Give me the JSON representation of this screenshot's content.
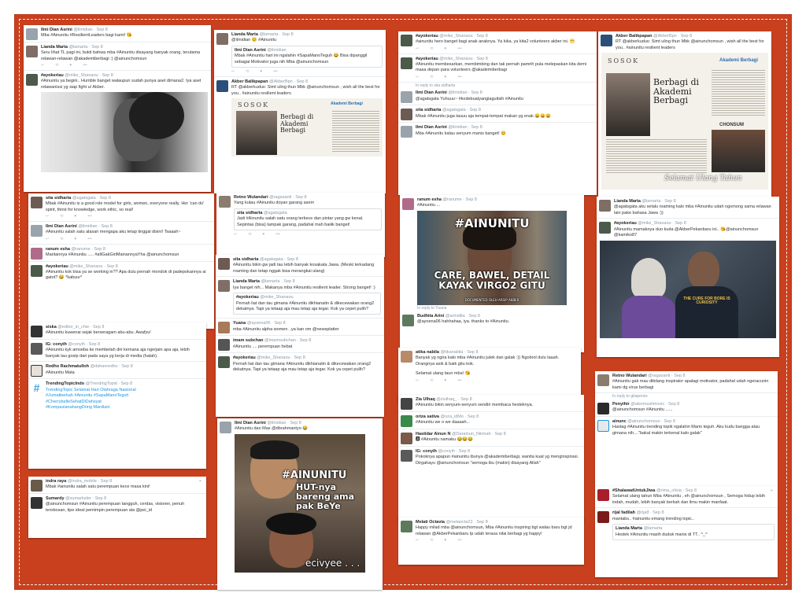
{
  "cards": {
    "c1": {
      "tweets": [
        {
          "name": "Ilmi Dian Asrini",
          "handle": "@ilmidian · Sep 8",
          "text": "Mba #Ainunitu #ResilientLeaders bagi kami! 😘"
        },
        {
          "name": "Lianda Marta",
          "handle": "@lamarta · Sep 8",
          "text": "Seru lihat TL pagi ini, bukti bahwa mba #Ainunitu disayang banyak orang, terutama relawan-relawan @akademiberbagi :) @ainunchomsun"
        },
        {
          "name": "#ayokeriau",
          "handle": "@mike_Shanaou · Sep 8",
          "text": "#Ainunitu ya begini.. Humble banget walaupun sudah punya aset dimana2. Iya aset relawanissi yg siap fight u/ Akber."
        }
      ]
    },
    "c2": {
      "tweets": [
        {
          "name": "Lianda Marta",
          "handle": "@lamarta · Sep 8",
          "text": "@ilmidian 😊 #Ainunitu"
        },
        {
          "name": "Akber Balikpapan",
          "handle": "@AkberBpn · Sep 8",
          "text": "RT @akberkudus: Simt uling thun Mbk @ainunchomsun , wish all the best for you.. #ainunitu resilient leaders"
        }
      ],
      "quote": {
        "name": "Ilmi Dian Asrini",
        "handle": "@ilmidian",
        "text": "Mbak #Ainunitu hari ini ngalahin #SapaManoTeguh 😂 Bisa dipanggil sebagai Motivator juga nih Mba @ainunchomsun"
      },
      "newspaper": {
        "section": "SOSOK",
        "headline": "Berbagi di Akademi Berbagi",
        "logo": "Akademi Berbagi"
      }
    },
    "c3": {
      "tweets": [
        {
          "name": "#ayokeriau",
          "handle": "@mike_Shanaou · Sep 8",
          "text": "#ainunitu hero banget bagi anak anaknya. Ya kika, ya kita2 volunteers akber ini. 😁"
        },
        {
          "name": "#ayokeriau",
          "handle": "@mike_Shanaou · Sep 8",
          "text": "#Ainunitu membesarkan, membimbing dan tak pernah pamrih pula melepaskan kita demi masa depan para volunteers @akademiberbagi"
        },
        {
          "name": "Ilmi Dian Asrini",
          "handle": "@ilmidian · Sep 8",
          "text": "@agatsgata Yuhuuu~ #kodebuatyangiaguitsih #Ainunitu",
          "replyto": "In reply to sita sidharta"
        },
        {
          "name": "sita sidharta",
          "handle": "@agatsgata · Sep 8",
          "text": "Mbak #Ainunitu juga tauuu aja tempat-tempat makan yg enak 😀😀😀"
        },
        {
          "name": "Ilmi Dian Asrini",
          "handle": "@ilmidian · Sep 8",
          "text": "Mba #Ainunitu kalau senyum manis banget! 😊"
        }
      ]
    },
    "c4": {
      "tweets": [
        {
          "name": "Akber Balikpapan",
          "handle": "@AkberBpn · Sep 8",
          "text": "RT @akberkudus: Simt uling thun Mbk @ainunchomsun , wish all the best for you.. #ainunitu resilient leaders"
        }
      ],
      "newspaper": {
        "section": "SOSOK",
        "headline": "Berbagi di Akademi Berbagi",
        "logo": "Akademi Berbagi",
        "caption": "Selamat Ulang Tahun",
        "extra": "CHONSUM"
      }
    },
    "c5": {
      "tweets": [
        {
          "name": "sita sidharta",
          "handle": "@agatsgata · Sep 8",
          "text": "Mbak #Ainunitu is a good role model for girls, women, everyone really. Her 'can do' spirit, thirst for knowledge, work ethic, so real!"
        },
        {
          "name": "Ilmi Dian Asrini",
          "handle": "@ilmidian · Sep 8",
          "text": "#Ainunitu salah satu alasan mengapa aku tetap tinggal disini! Tsaaah~"
        },
        {
          "name": "ranum esha",
          "handle": "@ranume · Sep 8",
          "text": "Mantannya #Ainunitu ..... #altGakGiriMainannyaYha @ainunchomsun"
        },
        {
          "name": "#ayokeriau",
          "handle": "@mike_Shanaou · Sep 8",
          "text": "#Ainunitu kok bisa ya se working in?? Apa dulu pernah mondok di padepokannya ai gatot? 😂 *kabuur*"
        }
      ]
    },
    "c6": {
      "tweets": [
        {
          "name": "Retno Wulandari",
          "handle": "@ragasanti · Sep 8",
          "text": "Yang kutau #Ainunitu doyan garang asem"
        }
      ],
      "quote": {
        "name": "sita sidharta",
        "handle": "@agatsgata",
        "text": "Jadi #Ainunitu salah satu orang terkece dan pintar yang gw kenal. Sepintas (bisa) tampak garang, padahal mah baiiik banget!"
      }
    },
    "c7": {
      "tweets": [
        {
          "name": "ranum esha",
          "handle": "@ranume · Sep 8",
          "text": "#Ainunitu ..."
        }
      ],
      "meme": {
        "top": "#AINUNITU",
        "bottom": "CARE, BAWEL, DETAIL KAYAK VIRGO2 GITU",
        "small": "DOCUMENTED OLEH ARSIP AKBER"
      },
      "reply": {
        "replyto": "In reply to Yuana",
        "name": "Budhita Arini",
        "handle": "@arinidita · Sep 8",
        "text": "@ayoena06 hahhahaa, iya. thanks to #Ainunitu."
      }
    },
    "c8": {
      "tweets": [
        {
          "name": "Lianda Marta",
          "handle": "@lamarta · Sep 8",
          "text": "@agatsgata aku selalu roaming kalo mba #Ainunitu udah ngomong sama relawan lain pake bahasa Jawa :))"
        },
        {
          "name": "#ayokeriau",
          "handle": "@mike_Shanaou · Sep 8",
          "text": "#Ainunitu mamaknya duo kuda @AkberPekanbaru ini.. 😘@ainunchomsun @kamiko87"
        }
      ],
      "photo_text": {
        "shirt": "THE CURE FOR BORE IS CURIOSITY"
      }
    },
    "c9": {
      "tweets": [
        {
          "name": "sita sidharta",
          "handle": "@agatsgata · Sep 8",
          "text": "#Ainunitu bikin gw jadi tau lebih banyak kosakata Jawa. (Meski terkadang roaming dan tetap nggak bisa merangkai ulang)"
        },
        {
          "name": "Lianda Marta",
          "handle": "@lamarta · Sep 8",
          "text": "Iya banget nih... Makanya mba #Ainunitu resilient leader. Strong banget! :)"
        },
        {
          "name": "Yuana",
          "handle": "@ayoena06 · Sep 8",
          "text": "mba #Ainunitu alpha women ..ya kan om @newsplatter"
        },
        {
          "name": "imam subchan",
          "handle": "@imamsubchan · Sep 8",
          "text": "#Ainunitu .... perempuan hebat"
        },
        {
          "name": "#ayokeriau",
          "handle": "@mike_Shanaou · Sep 8",
          "text": "Pernah liat dan tau gimana #Ainunitu dikhianatin & dikecewakan orang2 dekatnya. Tapi ya tetaap aja mau tetap aja tegar. Kok ya cepet pulih?"
        }
      ],
      "quote": {
        "name": "#ayokeriau",
        "handle": "@mike_Shanaou",
        "text": "Pernah liat dan tau gimana #Ainunitu dikhianatin & dikecewakan orang2 dekatnya. Tapi ya tetaap aja mau tetap aja tegar. Kok ya cepet pulih?"
      }
    },
    "c10": {
      "tweets": [
        {
          "name": "atika nabila",
          "handle": "@tikanabila · Sep 8",
          "text": "Banyak yg ngira kalo mba #Ainunitu jutek dan galak :)) Ngobrol dulu laaah. Orangnya asik & baik gitu kok."
        }
      ],
      "extra_text": "Selamat ulang taun mba! 😘"
    },
    "c11": {
      "tweets": [
        {
          "name": "siska",
          "handle": "@editor_in_chie · Sep 8",
          "text": "#Ainunitu kuwenai sejak berseragam abu-abu. Awafyu!"
        },
        {
          "name": "IG: conyih",
          "handle": "@conyih · Sep 8",
          "text": "#Ainunitu kyk amoeba ke membelah diri kemana aja ngerjain apa aja, lebih banyak tau gosip dari pada saya yg kerja di media (halah)."
        },
        {
          "name": "Redho Rachmatulloh",
          "handle": "@dahanredho · Sep 8",
          "text": "#Ainunitu Mata"
        },
        {
          "name": "TrendingTopicIndo",
          "handle": "@TrendingTopid · Sep 8",
          "text": "TrendingTopic Selamat Hari Olahraga Nasional #Jumatberkah #Ainunitu #SapaManoTeguh #CherrybelleSehatDiDahsyat #KompasianahangDring Mardiani"
        }
      ]
    },
    "c12": {
      "tweets": [
        {
          "name": "Ilmi Dian Asrini",
          "handle": "@ilmidian · Sep 8",
          "text": "#Ainunitu dan Mas @dbrahmantyo 😂"
        }
      ],
      "meme": {
        "top": "#AINUNITU",
        "mid": "HUT-nya bareng ama pak BeYe",
        "bottom": "ecivyee . . ."
      }
    },
    "c13": {
      "tweets": [
        {
          "name": "Zia Ulhaq",
          "handle": "@ziulhaq_ · Sep 8",
          "text": "#Ainunitu bikin senyum-senyum sendiri membaca hesteknya."
        },
        {
          "name": "oriza sativa",
          "handle": "@oza_idMo · Sep 8",
          "text": "#Ainunitu we o we daaaah..."
        },
        {
          "name": "Hastidar Ainun N",
          "handle": "@Darainun_Nikmah · Sep 8",
          "text": "🅰 #Ainunitu namaku 😂😂😂"
        },
        {
          "name": "IG: conyih",
          "handle": "@conyih · Sep 8",
          "text": "Pokoknya apapun #ainunitu ibunya @akademiberbagi, wanita kuat yg menginspirasi. Dirgahayu @ainunchomsun \"semoga ibu (makin) disayang Allah\""
        }
      ]
    },
    "c14": {
      "tweets": [
        {
          "name": "Retno Wulandari",
          "handle": "@ragasanti · Sep 8",
          "text": "#Ainunitu gak mau dibilang inspirator apalagi motivator, padahal udah ngeracunin kami dg virus berbagi"
        },
        {
          "name": "Penyihir",
          "handle": "@alexmuslimovic · Sep 8",
          "text": "@ainunchomsun #Ainunitu ......",
          "replyto": "In reply to gitapersis"
        },
        {
          "name": "ainunc",
          "handle": "@ainunchomsun · Sep 8",
          "text": "Hastag #Ainunitu trending topik ngalahin Mario teguh. Aku kudu bangga atau gimana nih....\"bakal makin terkenal kalo galak\""
        }
      ]
    },
    "c15": {
      "tweets": [
        {
          "name": "indra raya",
          "handle": "@indra_mobile · Sep 8",
          "text": "Mbak #ainunitu salah satu perempuan kece masa kini!"
        },
        {
          "name": "Sumardy",
          "handle": "@sumarkeler · Sep 8",
          "text": "@ainunchomsun #Ainunitu perempuan tangguh, cerdas, visioner, penuh terobosan, tipe ideal pemimpin perempuan ala @pei_id"
        }
      ]
    },
    "c16": {
      "tweets": [
        {
          "name": "Melati Octavia",
          "handle": "@melaocta22 · Sep 8",
          "text": "Happy milad mba @ainunchomsun, Mba #Ainunitu inspiring bgt walau baru bgt jd relawan @AkberPekanbaru tp udah terasa nilai berbagi yg happy!"
        }
      ]
    },
    "c17": {
      "tweets": [
        {
          "name": "#ShalawatUntukJiwa",
          "handle": "@rima_olivia · Sep 8",
          "text": "Selamat ulang tahun Mba #Ainunitu , eh @ainunchomsun , Semoga hidup lebih indah, mudah, lebih banyak berkah dan ilmu makin manfaat."
        },
        {
          "name": "rijal fadilah",
          "handle": "@rijalf · Sep 8",
          "text": "mantabs.. #ainunitu emang trending topic.."
        }
      ],
      "quote": {
        "name": "Lianda Marta",
        "handle": "@lamarta",
        "text": "Hestek #Ainunitu masih duduk manis di TT.. ^_^"
      }
    }
  },
  "action_icons": [
    "reply-icon",
    "retweet-icon",
    "like-icon",
    "more-icon"
  ],
  "colors": {
    "board": "#c9401e",
    "link": "#1b95e0",
    "muted": "#8899a6",
    "dashed_border": "#ffffff"
  }
}
